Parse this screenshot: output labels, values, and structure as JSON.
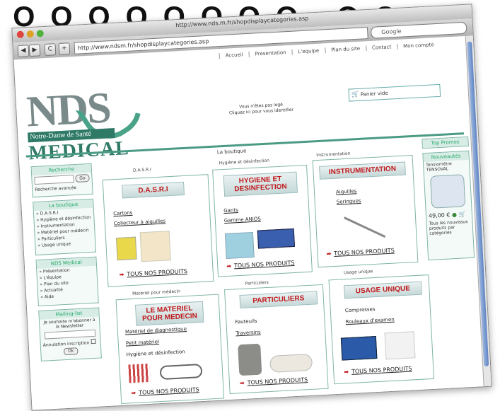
{
  "page_title": "ОООООООО ОООО",
  "window": {
    "title": "http://www.nds.m.fr/shopdisplaycategories.asp",
    "url": "http://www.ndsm.fr/shopdisplaycategories.asp",
    "search_placeholder": "Google",
    "back": "◀",
    "forward": "▶",
    "reload": "C",
    "add": "+"
  },
  "nav": [
    "Accueil",
    "Presentation",
    "L'equipe",
    "Plan du site",
    "Contact",
    "Mon compte"
  ],
  "logo": {
    "letters": "NDS",
    "band": "Notre-Dame de Santé",
    "medical": "MEDICAL"
  },
  "cart": {
    "info_line1": "Vous n'êtes pas logé",
    "info_line2": "Cliquez ici pour vous identifier",
    "box": "Panier vide"
  },
  "shop_title": "La boutique",
  "sidebar": {
    "search": {
      "title": "Recherche",
      "go": "Go",
      "advanced": "Recherche avancée"
    },
    "boutique": {
      "title": "La boutique",
      "items": [
        "D.A.S.R.I",
        "Hygiène et désinfection",
        "Instrumentation",
        "Matériel pour médecin",
        "Particuliers",
        "Usage unique"
      ]
    },
    "nds": {
      "title": "NDS Medical",
      "items": [
        "Présentation",
        "L'équipe",
        "Plan du site",
        "Actualité",
        "Aide"
      ]
    },
    "mailing": {
      "title": "Mailing-list",
      "text": "Je souhaite m'abonner à la Newsletter",
      "unsubscribe": "Annulation inscription",
      "ok": "Ok"
    }
  },
  "right": {
    "promo_title": "Top Promos",
    "news_title": "Nouveautés",
    "product_name": "Tensiomètre TENSOVAL",
    "price": "49,00 €",
    "all_news": "Tous les nouveaux produits par catégories"
  },
  "categories": [
    {
      "section": "D.A.S.R.I",
      "title": "D.A.S.R.I",
      "links": [
        "Cartons",
        "Collecteur à aiguilles"
      ],
      "all": "TOUS NOS PRODUITS"
    },
    {
      "section": "Hygiène et désinfection",
      "title": "HYGIENE ET DESINFECTION",
      "links": [
        "Gants",
        "Gamme ANIOS"
      ],
      "all": "TOUS NOS PRODUITS"
    },
    {
      "section": "Instrumentation",
      "title": "INSTRUMENTATION",
      "links": [
        "Aiguilles",
        "Seringues"
      ],
      "all": "TOUS NOS PRODUITS"
    },
    {
      "section": "Matériel pour médecin",
      "title": "LE MATERIEL POUR MEDECIN",
      "links": [
        "Matériel de diagnostique",
        "Petit matériel",
        "Hygiène et désinfection"
      ],
      "all": "TOUS NOS PRODUITS"
    },
    {
      "section": "Particuliers",
      "title": "PARTICULIERS",
      "links": [
        "Fauteuils",
        "Traversins"
      ],
      "all": "TOUS NOS PRODUITS"
    },
    {
      "section": "Usage unique",
      "title": "USAGE UNIQUE",
      "links": [
        "Compresses",
        "Rouleaux d'examen"
      ],
      "all": "TOUS NOS PRODUITS"
    }
  ],
  "colors": {
    "accent": "#2f7a66",
    "title_red": "#c0181c",
    "box_border": "#7fb5a5"
  }
}
